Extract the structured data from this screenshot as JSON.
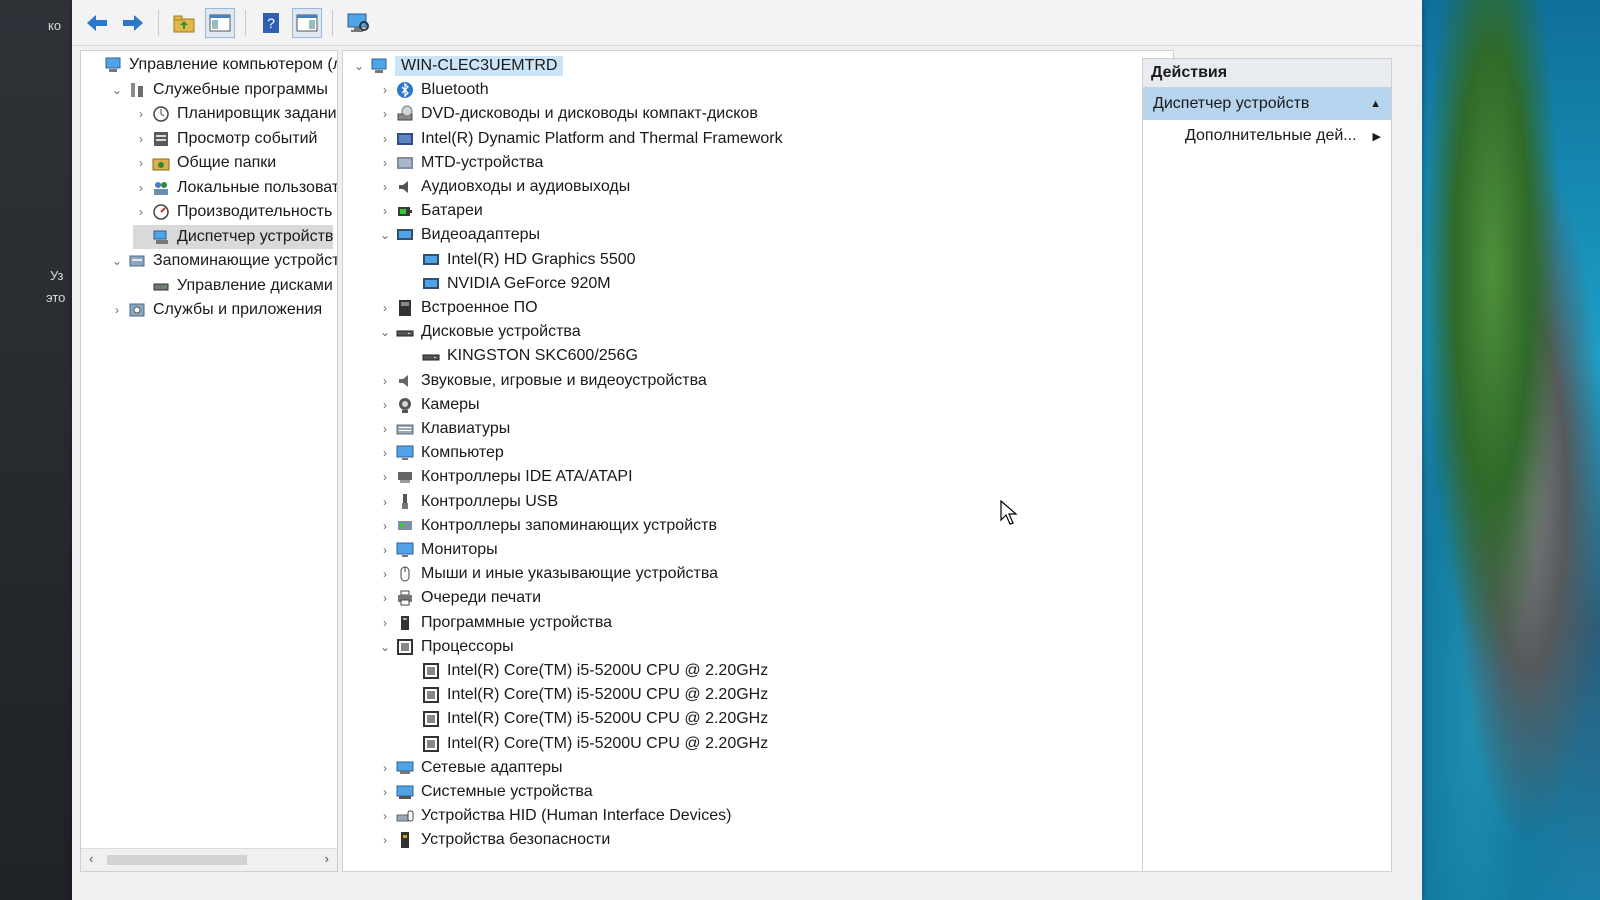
{
  "left_tree": [
    {
      "label": "Управление компьютером (л",
      "level": 0,
      "expander": "",
      "icon": "computer-management-icon"
    },
    {
      "label": "Служебные программы",
      "level": 1,
      "expander": "open",
      "icon": "tools-icon"
    },
    {
      "label": "Планировщик заданий",
      "level": 2,
      "expander": "closed",
      "icon": "clock-icon"
    },
    {
      "label": "Просмотр событий",
      "level": 2,
      "expander": "closed",
      "icon": "event-viewer-icon"
    },
    {
      "label": "Общие папки",
      "level": 2,
      "expander": "closed",
      "icon": "shared-folder-icon"
    },
    {
      "label": "Локальные пользовате",
      "level": 2,
      "expander": "closed",
      "icon": "users-icon"
    },
    {
      "label": "Производительность",
      "level": 2,
      "expander": "closed",
      "icon": "performance-icon"
    },
    {
      "label": "Диспетчер устройств",
      "level": 2,
      "expander": "",
      "icon": "device-manager-icon",
      "selected": true
    },
    {
      "label": "Запоминающие устройст",
      "level": 1,
      "expander": "open",
      "icon": "storage-icon"
    },
    {
      "label": "Управление дисками",
      "level": 2,
      "expander": "",
      "icon": "disk-management-icon"
    },
    {
      "label": "Службы и приложения",
      "level": 1,
      "expander": "closed",
      "icon": "services-icon"
    }
  ],
  "device_tree": [
    {
      "label": "WIN-CLEC3UEMTRD",
      "level": 0,
      "expander": "open",
      "icon": "computer-icon",
      "root": true
    },
    {
      "label": "Bluetooth",
      "level": 1,
      "expander": "closed",
      "icon": "bluetooth-icon"
    },
    {
      "label": "DVD-дисководы и дисководы компакт-дисков",
      "level": 1,
      "expander": "closed",
      "icon": "dvd-icon"
    },
    {
      "label": "Intel(R) Dynamic Platform and Thermal Framework",
      "level": 1,
      "expander": "closed",
      "icon": "thermal-icon"
    },
    {
      "label": "MTD-устройства",
      "level": 1,
      "expander": "closed",
      "icon": "mtd-icon"
    },
    {
      "label": "Аудиовходы и аудиовыходы",
      "level": 1,
      "expander": "closed",
      "icon": "speaker-icon"
    },
    {
      "label": "Батареи",
      "level": 1,
      "expander": "closed",
      "icon": "battery-icon"
    },
    {
      "label": "Видеоадаптеры",
      "level": 1,
      "expander": "open",
      "icon": "display-adapter-icon"
    },
    {
      "label": "Intel(R) HD Graphics 5500",
      "level": 2,
      "expander": "",
      "icon": "display-adapter-icon"
    },
    {
      "label": "NVIDIA GeForce 920M",
      "level": 2,
      "expander": "",
      "icon": "display-adapter-icon"
    },
    {
      "label": "Встроенное ПО",
      "level": 1,
      "expander": "closed",
      "icon": "firmware-icon"
    },
    {
      "label": "Дисковые устройства",
      "level": 1,
      "expander": "open",
      "icon": "disk-drive-icon"
    },
    {
      "label": "KINGSTON SKC600/256G",
      "level": 2,
      "expander": "",
      "icon": "disk-drive-icon"
    },
    {
      "label": "Звуковые, игровые и видеоустройства",
      "level": 1,
      "expander": "closed",
      "icon": "sound-icon"
    },
    {
      "label": "Камеры",
      "level": 1,
      "expander": "closed",
      "icon": "camera-icon"
    },
    {
      "label": "Клавиатуры",
      "level": 1,
      "expander": "closed",
      "icon": "keyboard-icon"
    },
    {
      "label": "Компьютер",
      "level": 1,
      "expander": "closed",
      "icon": "monitor-icon"
    },
    {
      "label": "Контроллеры IDE ATA/ATAPI",
      "level": 1,
      "expander": "closed",
      "icon": "ide-controller-icon"
    },
    {
      "label": "Контроллеры USB",
      "level": 1,
      "expander": "closed",
      "icon": "usb-icon"
    },
    {
      "label": "Контроллеры запоминающих устройств",
      "level": 1,
      "expander": "closed",
      "icon": "storage-controller-icon"
    },
    {
      "label": "Мониторы",
      "level": 1,
      "expander": "closed",
      "icon": "monitor-icon"
    },
    {
      "label": "Мыши и иные указывающие устройства",
      "level": 1,
      "expander": "closed",
      "icon": "mouse-icon"
    },
    {
      "label": "Очереди печати",
      "level": 1,
      "expander": "closed",
      "icon": "printer-icon"
    },
    {
      "label": "Программные устройства",
      "level": 1,
      "expander": "closed",
      "icon": "software-device-icon"
    },
    {
      "label": "Процессоры",
      "level": 1,
      "expander": "open",
      "icon": "processor-icon"
    },
    {
      "label": "Intel(R) Core(TM) i5-5200U CPU @ 2.20GHz",
      "level": 2,
      "expander": "",
      "icon": "processor-icon"
    },
    {
      "label": "Intel(R) Core(TM) i5-5200U CPU @ 2.20GHz",
      "level": 2,
      "expander": "",
      "icon": "processor-icon"
    },
    {
      "label": "Intel(R) Core(TM) i5-5200U CPU @ 2.20GHz",
      "level": 2,
      "expander": "",
      "icon": "processor-icon"
    },
    {
      "label": "Intel(R) Core(TM) i5-5200U CPU @ 2.20GHz",
      "level": 2,
      "expander": "",
      "icon": "processor-icon"
    },
    {
      "label": "Сетевые адаптеры",
      "level": 1,
      "expander": "closed",
      "icon": "network-adapter-icon"
    },
    {
      "label": "Системные устройства",
      "level": 1,
      "expander": "closed",
      "icon": "system-device-icon"
    },
    {
      "label": "Устройства HID (Human Interface Devices)",
      "level": 1,
      "expander": "closed",
      "icon": "hid-icon"
    },
    {
      "label": "Устройства безопасности",
      "level": 1,
      "expander": "closed",
      "icon": "security-device-icon"
    }
  ],
  "actions": {
    "header": "Действия",
    "section": "Диспетчер устройств",
    "more": "Дополнительные дей..."
  },
  "desktop": {
    "left_text_1": "ко",
    "left_text_2": "Уз",
    "left_text_3": "это"
  },
  "colors": {
    "selection": "#cce4f7",
    "actions_section": "#b7d4ee",
    "accent": "#2b6fb0"
  }
}
